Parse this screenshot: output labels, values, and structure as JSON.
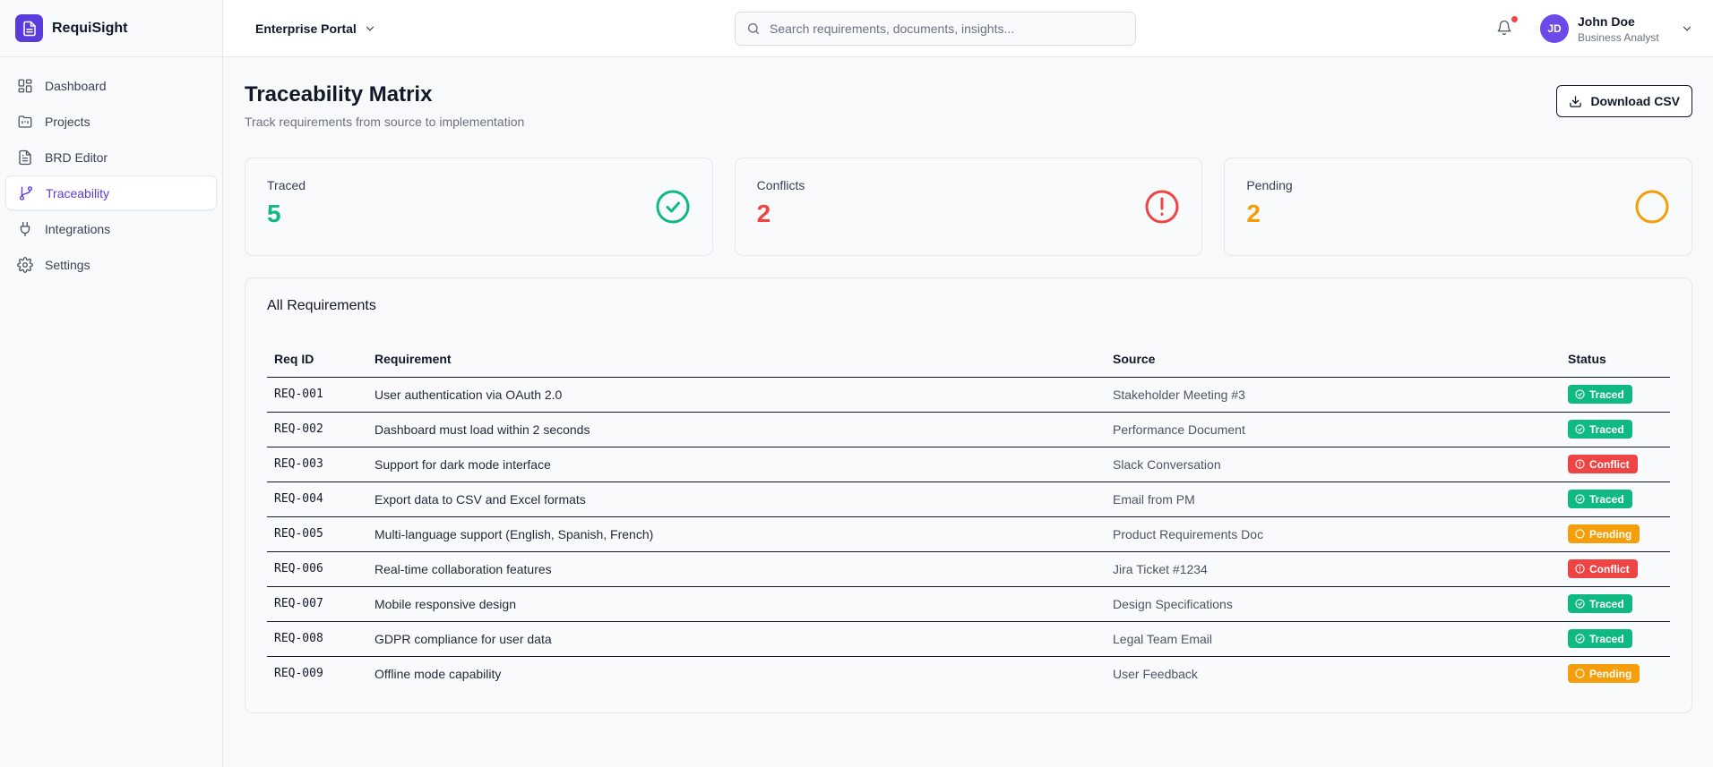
{
  "brand": {
    "name": "RequiSight"
  },
  "sidebar": {
    "items": [
      {
        "label": "Dashboard",
        "icon": "grid-icon",
        "active": false
      },
      {
        "label": "Projects",
        "icon": "folder-icon",
        "active": false
      },
      {
        "label": "BRD Editor",
        "icon": "document-icon",
        "active": false
      },
      {
        "label": "Traceability",
        "icon": "branch-icon",
        "active": true
      },
      {
        "label": "Integrations",
        "icon": "plug-icon",
        "active": false
      },
      {
        "label": "Settings",
        "icon": "gear-icon",
        "active": false
      }
    ]
  },
  "topbar": {
    "portal": "Enterprise Portal",
    "search_placeholder": "Search requirements, documents, insights...",
    "user": {
      "initials": "JD",
      "name": "John Doe",
      "role": "Business Analyst"
    }
  },
  "page": {
    "title": "Traceability Matrix",
    "subtitle": "Track requirements from source to implementation",
    "download_label": "Download CSV"
  },
  "stats": [
    {
      "label": "Traced",
      "value": "5",
      "color": "#10b981",
      "icon": "check-circle-icon"
    },
    {
      "label": "Conflicts",
      "value": "2",
      "color": "#ef4444",
      "icon": "alert-circle-icon"
    },
    {
      "label": "Pending",
      "value": "2",
      "color": "#f59e0b",
      "icon": "circle-icon"
    }
  ],
  "table": {
    "title": "All Requirements",
    "columns": [
      "Req ID",
      "Requirement",
      "Source",
      "Status"
    ],
    "rows": [
      {
        "id": "REQ-001",
        "requirement": "User authentication via OAuth 2.0",
        "source": "Stakeholder Meeting #3",
        "status": "Traced"
      },
      {
        "id": "REQ-002",
        "requirement": "Dashboard must load within 2 seconds",
        "source": "Performance Document",
        "status": "Traced"
      },
      {
        "id": "REQ-003",
        "requirement": "Support for dark mode interface",
        "source": "Slack Conversation",
        "status": "Conflict"
      },
      {
        "id": "REQ-004",
        "requirement": "Export data to CSV and Excel formats",
        "source": "Email from PM",
        "status": "Traced"
      },
      {
        "id": "REQ-005",
        "requirement": "Multi-language support (English, Spanish, French)",
        "source": "Product Requirements Doc",
        "status": "Pending"
      },
      {
        "id": "REQ-006",
        "requirement": "Real-time collaboration features",
        "source": "Jira Ticket #1234",
        "status": "Conflict"
      },
      {
        "id": "REQ-007",
        "requirement": "Mobile responsive design",
        "source": "Design Specifications",
        "status": "Traced"
      },
      {
        "id": "REQ-008",
        "requirement": "GDPR compliance for user data",
        "source": "Legal Team Email",
        "status": "Traced"
      },
      {
        "id": "REQ-009",
        "requirement": "Offline mode capability",
        "source": "User Feedback",
        "status": "Pending"
      }
    ]
  },
  "colors": {
    "accent": "#5b3bdc",
    "traced": "#10b981",
    "conflict": "#ef4444",
    "pending": "#f59e0b"
  }
}
